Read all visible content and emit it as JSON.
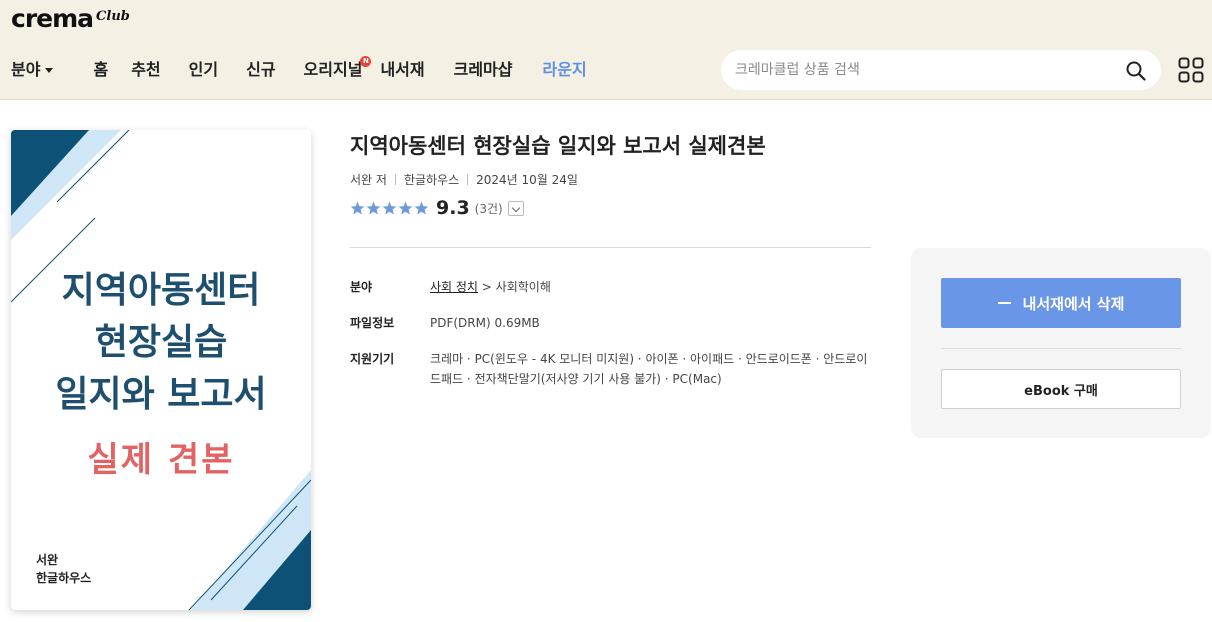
{
  "logo": {
    "main": "crema",
    "sub": "Club"
  },
  "nav": {
    "category": "분야",
    "items": [
      "홈",
      "추천",
      "인기",
      "신규",
      "오리지널",
      "내서재",
      "크레마샵"
    ],
    "lounge": "라운지",
    "new_badge": "N"
  },
  "search": {
    "placeholder": "크레마클럽 상품 검색"
  },
  "cover": {
    "title_lines": [
      "지역아동센터",
      "현장실습",
      "일지와 보고서"
    ],
    "subtitle": "실제 견본",
    "author": "서완",
    "publisher": "한글하우스",
    "colors": {
      "navy": "#0d5176",
      "light_blue": "#cfe6f6",
      "title": "#1e4f6e",
      "subtitle": "#e36363"
    }
  },
  "book": {
    "title": "지역아동센터 현장실습 일지와 보고서 실제견본",
    "author": "서완 저",
    "publisher": "한글하우스",
    "date": "2024년 10월 24일",
    "rating": {
      "score": "9.3",
      "count": "(3건)",
      "stars_filled": 5,
      "stars_total": 5,
      "star_color": "#6b9bd8"
    }
  },
  "info": {
    "category_label": "분야",
    "category_link": "사회 정치",
    "category_sub": " > 사회학이해",
    "file_label": "파일정보",
    "file_value": "PDF(DRM) 0.69MB",
    "device_label": "지원기기",
    "device_value": "크레마 · PC(윈도우 - 4K 모니터 미지원) · 아이폰 · 아이패드 · 안드로이드폰 · 안드로이드패드 · 전자책단말기(저사양 기기 사용 불가) · PC(Mac)"
  },
  "actions": {
    "remove_label": "내서재에서 삭제",
    "buy_label": "eBook 구매",
    "accent": "#6996e6"
  }
}
